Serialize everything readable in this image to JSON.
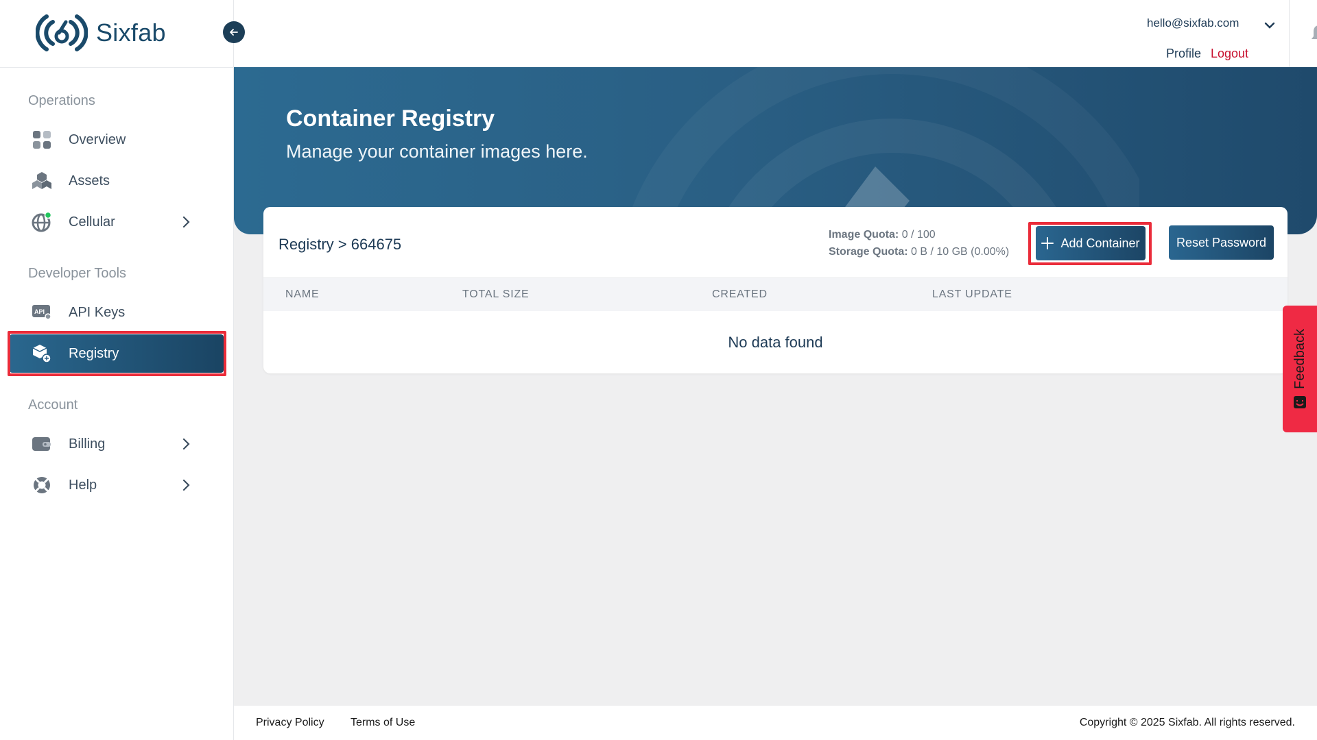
{
  "brand": {
    "name": "Sixfab"
  },
  "header": {
    "user_email": "hello@sixfab.com",
    "profile_label": "Profile",
    "logout_label": "Logout"
  },
  "sidebar": {
    "sections": [
      {
        "title": "Operations"
      },
      {
        "title": "Developer Tools"
      },
      {
        "title": "Account"
      }
    ],
    "items": [
      {
        "label": "Overview",
        "icon": "grid-icon"
      },
      {
        "label": "Assets",
        "icon": "boxes-icon"
      },
      {
        "label": "Cellular",
        "icon": "globe-icon",
        "has_submenu": true,
        "status_color": "#22c55e"
      },
      {
        "label": "API Keys",
        "icon": "api-key-icon"
      },
      {
        "label": "Registry",
        "icon": "registry-icon",
        "active": true
      },
      {
        "label": "Billing",
        "icon": "wallet-icon",
        "has_submenu": true
      },
      {
        "label": "Help",
        "icon": "lifebuoy-icon",
        "has_submenu": true
      }
    ]
  },
  "hero": {
    "title": "Container Registry",
    "subtitle": "Manage your container images here."
  },
  "registry": {
    "breadcrumb": "Registry > 664675",
    "image_quota_label": "Image Quota:",
    "image_quota_value": "0 / 100",
    "storage_quota_label": "Storage Quota:",
    "storage_quota_value": "0 B / 10 GB (0.00%)",
    "add_button": "Add Container",
    "reset_button": "Reset Password",
    "columns": [
      "NAME",
      "TOTAL SIZE",
      "CREATED",
      "LAST UPDATE"
    ],
    "rows": [],
    "empty_message": "No data found"
  },
  "feedback": {
    "label": "Feedback"
  },
  "footer": {
    "privacy": "Privacy Policy",
    "terms": "Terms of Use",
    "copyright": "Copyright © 2025 Sixfab. All rights reserved."
  },
  "colors": {
    "brand_primary": "#1f4a6c",
    "highlight": "#ea2c3a",
    "logout": "#c8102e",
    "feedback": "#ef2a44"
  }
}
